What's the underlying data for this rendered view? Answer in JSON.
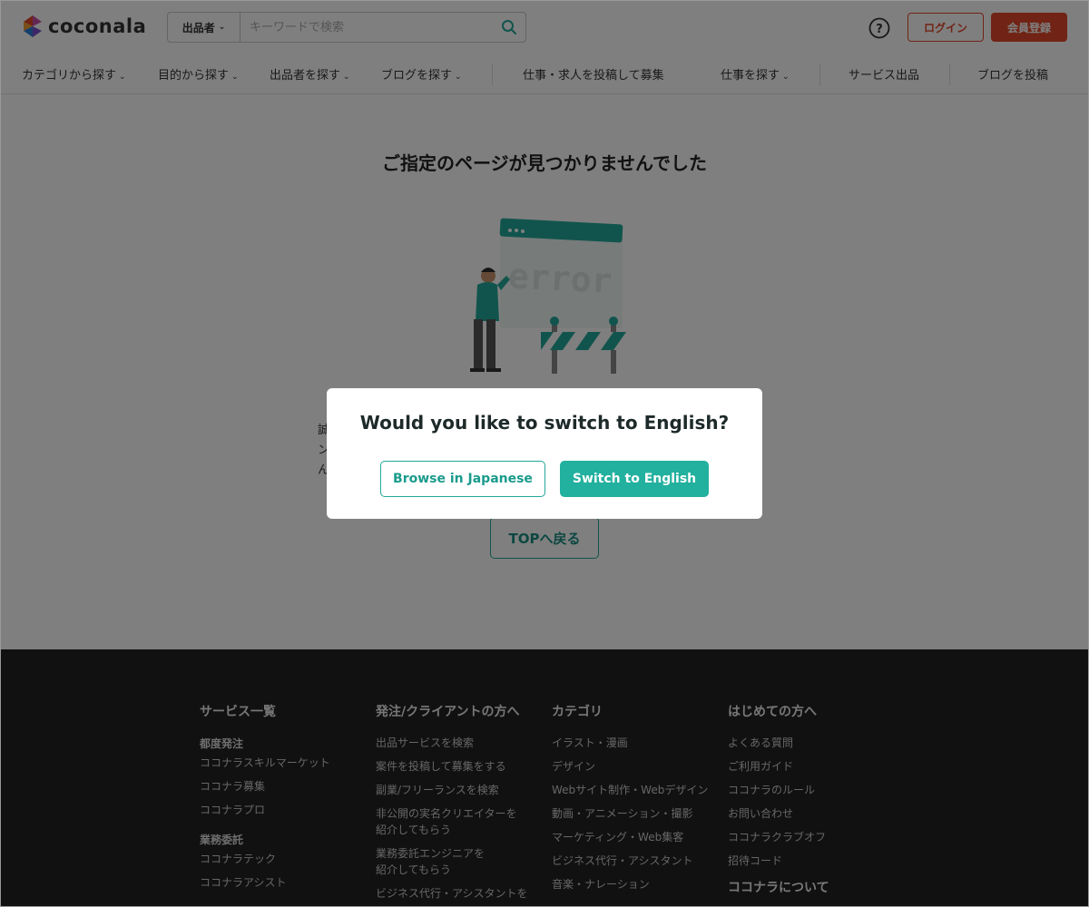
{
  "header": {
    "logo_text": "coconala",
    "search": {
      "type_label": "出品者",
      "placeholder": "キーワードで検索"
    },
    "login_label": "ログイン",
    "signup_label": "会員登録"
  },
  "nav": {
    "items": [
      {
        "label": "カテゴリから探す"
      },
      {
        "label": "目的から探す"
      },
      {
        "label": "出品者を探す"
      },
      {
        "label": "ブログを探す"
      },
      {
        "label": "仕事・求人を投稿して募集"
      },
      {
        "label": "仕事を探す"
      },
      {
        "label": "サービス出品"
      },
      {
        "label": "ブログを投稿"
      }
    ]
  },
  "main": {
    "title": "ご指定のページが見つかりませんでした",
    "illustration_text": "error",
    "body_text_fragment": [
      "誠",
      "ン",
      "ん"
    ],
    "top_button_label": "TOPへ戻る"
  },
  "footer": {
    "columns": [
      {
        "heading": "サービス一覧",
        "subheading1": "都度発注",
        "links1": [
          "ココナラスキルマーケット",
          "ココナラ募集",
          "ココナラプロ"
        ],
        "subheading2": "業務委託",
        "links2": [
          "ココナラテック",
          "ココナラアシスト"
        ]
      },
      {
        "heading": "発注/クライアントの方へ",
        "links": [
          "出品サービスを検索",
          "案件を投稿して募集をする",
          "副業/フリーランスを検索",
          "非公開の実名クリエイターを",
          "紹介してもらう",
          "業務委託エンジニアを",
          "紹介してもらう",
          "ビジネス代行・アシスタントを"
        ]
      },
      {
        "heading": "カテゴリ",
        "links": [
          "イラスト・漫画",
          "デザイン",
          "Webサイト制作・Webデザイン",
          "動画・アニメーション・撮影",
          "マーケティング・Web集客",
          "ビジネス代行・アシスタント",
          "音楽・ナレーション"
        ]
      },
      {
        "heading": "はじめての方へ",
        "links": [
          "よくある質問",
          "ご利用ガイド",
          "ココナラのルール",
          "お問い合わせ",
          "ココナラクラブオフ",
          "招待コード"
        ],
        "heading2": "ココナラについて"
      }
    ]
  },
  "modal": {
    "title": "Would you like to switch to English?",
    "browse_japanese_label": "Browse in Japanese",
    "switch_english_label": "Switch to English"
  },
  "colors": {
    "accent_red": "#e2492b",
    "accent_teal": "#22b09f",
    "footer_bg": "#222222"
  }
}
